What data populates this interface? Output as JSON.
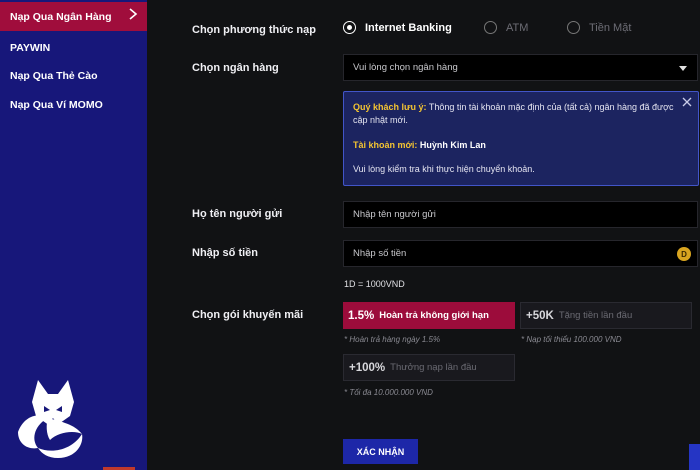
{
  "sidebar": {
    "items": [
      {
        "label": "Nạp Qua Ngân Hàng",
        "active": true
      },
      {
        "label": "PAYWIN"
      },
      {
        "label": "Nạp Qua Thẻ Cào"
      },
      {
        "label": "Nạp Qua Ví MOMO"
      }
    ]
  },
  "form": {
    "method_label": "Chọn phương thức nạp",
    "methods": [
      "Internet Banking",
      "ATM",
      "Tiền Mặt"
    ],
    "selected_method": "Internet Banking",
    "bank_label": "Chọn ngân hàng",
    "bank_placeholder": "Vui lòng chọn ngân hàng",
    "notice": {
      "title": "Quý khách lưu ý:",
      "text1": "Thông tin tài khoản mặc định của (tất cả) ngân hàng đã được",
      "text2": "cập nhật mới.",
      "account_label": "Tài khoản mới:",
      "account_name": "Huỳnh Kim Lan",
      "check": "Vui lòng kiểm tra khi thực hiện chuyển khoản."
    },
    "sender_label": "Họ tên người gửi",
    "sender_placeholder": "Nhập tên người gửi",
    "amount_label": "Nhập số tiền",
    "amount_placeholder": "Nhập số tiền",
    "coin_symbol": "D",
    "rate": "1D = 1000VND",
    "promo_label": "Chọn gói khuyến mãi",
    "promos": [
      {
        "big": "1.5%",
        "desc": "Hoàn trả không giới hạn",
        "note": "* Hoàn trả hàng ngày 1.5%",
        "selected": true
      },
      {
        "big": "+50K",
        "desc": "Tặng tiền lần đầu",
        "note": "* Nạp tối thiểu 100.000 VND"
      },
      {
        "big": "+100%",
        "desc": "Thưởng nạp lần đầu",
        "note": "* Tối đa 10.000.000 VND"
      }
    ],
    "confirm_label": "XÁC NHẬN"
  },
  "colors": {
    "sidebar_bg": "#17177a",
    "active_item": "#a00d3c",
    "accent_yellow": "#f4c431",
    "confirm_bg": "#1d27a8"
  },
  "icons": {
    "chevron": "chevron-right-icon",
    "close": "close-icon",
    "logo": "fox-logo-icon",
    "caret": "caret-down-icon",
    "coin": "coin-icon"
  }
}
